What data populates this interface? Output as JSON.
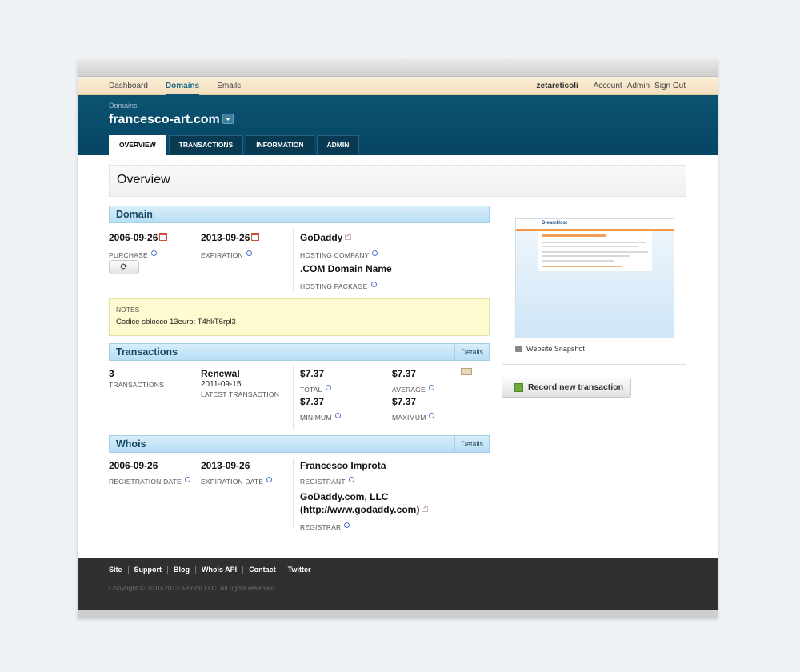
{
  "topnav": {
    "items": [
      "Dashboard",
      "Domains",
      "Emails"
    ],
    "user": "zetareticoli —",
    "account": "Account",
    "admin": "Admin",
    "signout": "Sign Out"
  },
  "header": {
    "breadcrumb": "Domains",
    "domain": "francesco-art.com",
    "tabs": [
      "OVERVIEW",
      "TRANSACTIONS",
      "INFORMATION",
      "ADMIN"
    ]
  },
  "overview_title": "Overview",
  "domain_section": {
    "title": "Domain",
    "purchase_date": "2006-09-26",
    "purchase_label": "PURCHASE",
    "expiration_date": "2013-09-26",
    "expiration_label": "EXPIRATION",
    "hosting_company": "GoDaddy",
    "hosting_company_label": "HOSTING COMPANY",
    "hosting_package": ".COM Domain Name",
    "hosting_package_label": "HOSTING PACKAGE",
    "refresh_icon": "⟳"
  },
  "notes": {
    "label": "NOTES",
    "text": "Codice sblocco 13euro: T4hkT6rpl3"
  },
  "transactions": {
    "title": "Transactions",
    "details": "Details",
    "count": "3",
    "count_label": "TRANSACTIONS",
    "latest_type": "Renewal",
    "latest_date": "2011-09-15",
    "latest_label": "LATEST TRANSACTION",
    "total": "$7.37",
    "total_label": "TOTAL",
    "average": "$7.37",
    "average_label": "AVERAGE",
    "minimum": "$7.37",
    "minimum_label": "MINIMUM",
    "maximum": "$7.37",
    "maximum_label": "MAXIMUM"
  },
  "whois": {
    "title": "Whois",
    "details": "Details",
    "registration_date": "2006-09-26",
    "registration_label": "REGISTRATION DATE",
    "expiration_date": "2013-09-26",
    "expiration_label": "EXPIRATION DATE",
    "registrant": "Francesco Improta",
    "registrant_label": "REGISTRANT",
    "registrar_line1": "GoDaddy.com, LLC",
    "registrar_line2": "(http://www.godaddy.com)",
    "registrar_label": "REGISTRAR"
  },
  "snapshot": {
    "logo": "DreamHost",
    "caption": "Website Snapshot"
  },
  "record_button": "Record new transaction",
  "footer": {
    "links": [
      "Site",
      "Support",
      "Blog",
      "Whois API",
      "Contact",
      "Twitter"
    ],
    "copyright": "Copyright © 2010-2013 Aetrion LLC. All rights reserved."
  },
  "colors": {
    "header_bg": "#0c5372",
    "section_bar": "#b7ddf4",
    "notes_bg": "#fdfbcf",
    "footer_bg": "#303030"
  },
  "icons": [
    "calendar-icon",
    "help-icon",
    "external-link-icon",
    "refresh-icon",
    "money-icon",
    "camera-icon",
    "add-transaction-icon",
    "dropdown-icon"
  ]
}
